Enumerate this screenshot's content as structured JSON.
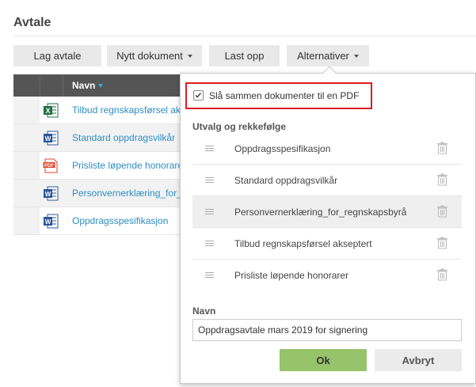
{
  "page": {
    "title": "Avtale"
  },
  "toolbar": {
    "lag_avtale": "Lag avtale",
    "nytt_dokument": "Nytt dokument",
    "last_opp": "Last opp",
    "alternativer": "Alternativer"
  },
  "table": {
    "column_name": "Navn",
    "rows": [
      {
        "label": "Tilbud regnskapsførsel ak",
        "file_type": "excel-icon"
      },
      {
        "label": "Standard oppdragsvilkår",
        "file_type": "word-icon"
      },
      {
        "label": "Prisliste løpende honorarer",
        "file_type": "pdf-icon"
      },
      {
        "label": "Personvernerklæring_for_",
        "file_type": "word-icon"
      },
      {
        "label": "Oppdragsspesifikasjon",
        "file_type": "word-icon"
      }
    ]
  },
  "panel": {
    "merge_label": "Slå sammen dokumenter til en PDF",
    "merge_checked": true,
    "order_heading": "Utvalg og rekkefølge",
    "order_items": [
      "Oppdragsspesifikasjon",
      "Standard oppdragsvilkår",
      "Personvernerklæring_for_regnskapsbyrå",
      "Tilbud regnskapsførsel akseptert",
      "Prisliste løpende honorarer"
    ],
    "name_heading": "Navn",
    "name_value": "Oppdragsavtale mars 2019 for signering",
    "ok_label": "Ok",
    "cancel_label": "Avbryt"
  },
  "colors": {
    "link": "#2c8ec4",
    "header_bg": "#555555",
    "ok_button": "#97c36a",
    "highlight_border": "#e11b22",
    "excel": "#1e7145",
    "word": "#2b579a",
    "pdf": "#e2402a"
  }
}
